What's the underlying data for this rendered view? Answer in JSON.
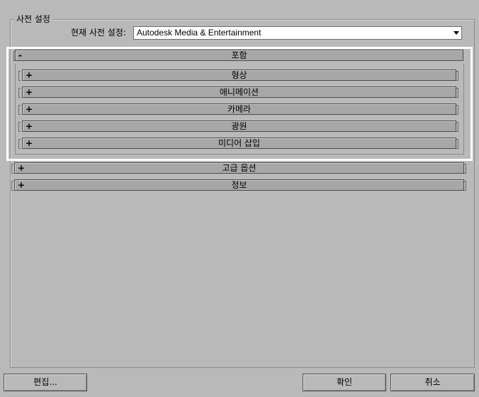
{
  "presets": {
    "group_label": "사전 설정",
    "current_label": "현재 사전 설정:",
    "current_value": "Autodesk Media & Entertainment"
  },
  "rollouts": {
    "include": {
      "toggle": "-",
      "title": "포함"
    },
    "sub": [
      {
        "toggle": "+",
        "title": "형상"
      },
      {
        "toggle": "+",
        "title": "애니메이션"
      },
      {
        "toggle": "+",
        "title": "카메라"
      },
      {
        "toggle": "+",
        "title": "광원"
      },
      {
        "toggle": "+",
        "title": "미디어 삽입"
      }
    ],
    "advanced": {
      "toggle": "+",
      "title": "고급 옵션"
    },
    "info": {
      "toggle": "+",
      "title": "정보"
    }
  },
  "buttons": {
    "edit": "편집...",
    "ok": "확인",
    "cancel": "취소"
  },
  "colors": {
    "background": "#b9b9b9",
    "rollout": "#a7a7a7",
    "highlight": "#ffffff"
  }
}
